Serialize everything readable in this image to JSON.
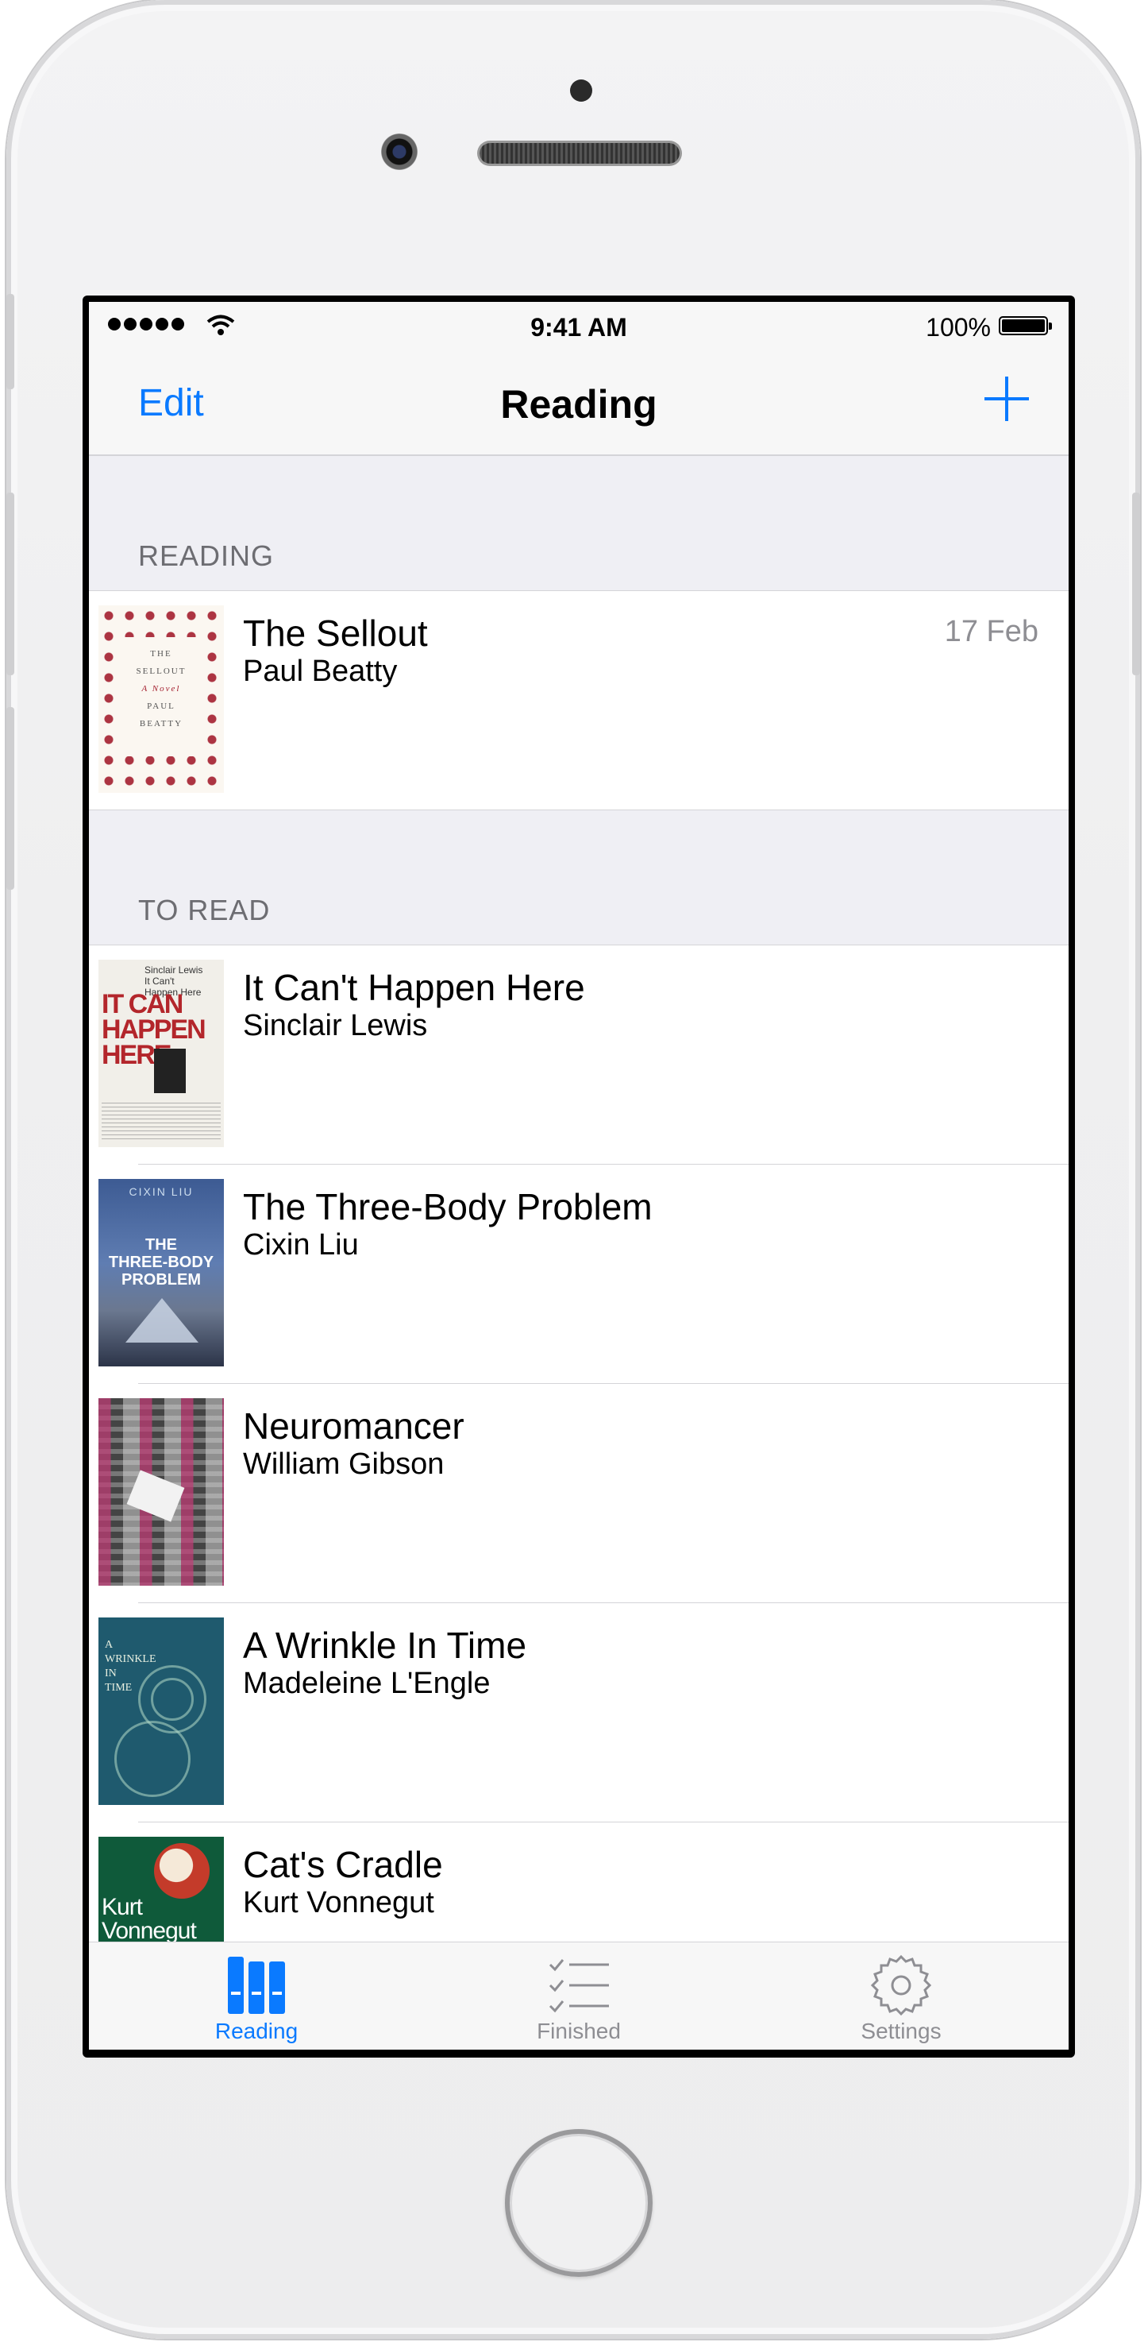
{
  "status_bar": {
    "time": "9:41 AM",
    "battery": "100%",
    "icons": [
      "signal-icon",
      "wifi-icon",
      "battery-icon"
    ]
  },
  "nav": {
    "edit_label": "Edit",
    "title": "Reading",
    "add_icon": "plus-icon"
  },
  "sections": [
    {
      "header": "READING",
      "books": [
        {
          "title": "The Sellout",
          "author": "Paul Beatty",
          "date": "17 Feb"
        }
      ]
    },
    {
      "header": "TO READ",
      "books": [
        {
          "title": "It Can't Happen Here",
          "author": "Sinclair Lewis"
        },
        {
          "title": "The Three-Body Problem",
          "author": "Cixin Liu"
        },
        {
          "title": "Neuromancer",
          "author": "William Gibson"
        },
        {
          "title": "A Wrinkle In Time",
          "author": "Madeleine L'Engle"
        },
        {
          "title": "Cat's Cradle",
          "author": "Kurt Vonnegut"
        }
      ]
    }
  ],
  "covers": {
    "sellout": {
      "line1": "THE",
      "line2": "SELLOUT",
      "line3": "A Novel",
      "line4": "PAUL",
      "line5": "BEATTY"
    },
    "ithappen": {
      "small": "Sinclair Lewis\nIt Can't\nHappen Here",
      "big": "IT CAN\nHAPPEN\nHERE"
    },
    "threebody": {
      "author": "CIXIN LIU",
      "title": "THE\nTHREE-BODY\nPROBLEM"
    },
    "wrinkle": {
      "title": "A\nWRINKLE\nIN\nTIME"
    },
    "cats": {
      "author": "Kurt\nVonnegut"
    }
  },
  "tabs": [
    {
      "label": "Reading",
      "icon": "books-icon",
      "active": true
    },
    {
      "label": "Finished",
      "icon": "checklist-icon",
      "active": false
    },
    {
      "label": "Settings",
      "icon": "gear-icon",
      "active": false
    }
  ],
  "colors": {
    "accent": "#0a7aff",
    "inactive": "#8e8e93",
    "section_bg": "#efeff4"
  }
}
